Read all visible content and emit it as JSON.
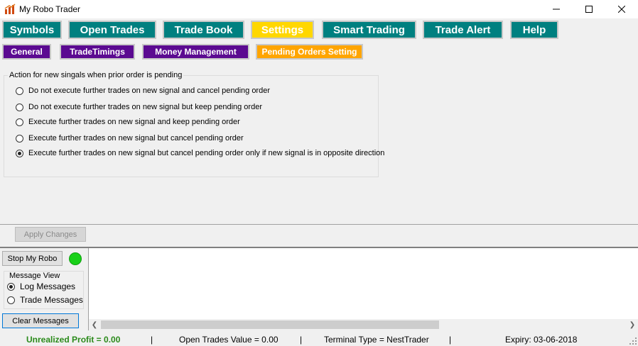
{
  "window": {
    "title": "My Robo Trader"
  },
  "main_tabs": [
    {
      "label": "Symbols"
    },
    {
      "label": "Open Trades"
    },
    {
      "label": "Trade Book"
    },
    {
      "label": "Settings"
    },
    {
      "label": "Smart Trading"
    },
    {
      "label": "Trade Alert"
    },
    {
      "label": "Help"
    }
  ],
  "sub_tabs": [
    {
      "label": "General"
    },
    {
      "label": "TradeTimings"
    },
    {
      "label": "Money Management"
    },
    {
      "label": "Pending Orders Setting"
    }
  ],
  "pending_group": {
    "legend": "Action for new singals when prior order is pending",
    "options": [
      {
        "label": "Do not execute further trades on new signal and cancel pending order"
      },
      {
        "label": "Do not execute further trades on new signal but keep pending order"
      },
      {
        "label": "Execute further trades on new signal and keep pending order"
      },
      {
        "label": "Execute further trades on new signal but cancel pending order"
      },
      {
        "label": "Execute further trades on new signal but cancel pending order only if new signal is in opposite direction"
      }
    ],
    "selected_index": 4
  },
  "apply_button": "Apply Changes",
  "stop_button": "Stop My Robo",
  "message_view": {
    "legend": "Message View",
    "options": [
      {
        "label": "Log Messages"
      },
      {
        "label": "Trade Messages"
      }
    ],
    "selected_index": 0
  },
  "clear_button": "Clear Messages",
  "status": {
    "unrealized": "Unrealized Profit = 0.00",
    "open_value": "Open Trades Value = 0.00",
    "terminal": "Terminal Type = NestTrader",
    "expiry": "Expiry: 03-06-2018",
    "separator": "|"
  },
  "colors": {
    "teal": "#008080",
    "purple": "#5b0a91",
    "active_main": "#ffd700",
    "active_sub": "#ffa500",
    "status_green": "#18d018",
    "profit_green": "#2a8a1a"
  }
}
